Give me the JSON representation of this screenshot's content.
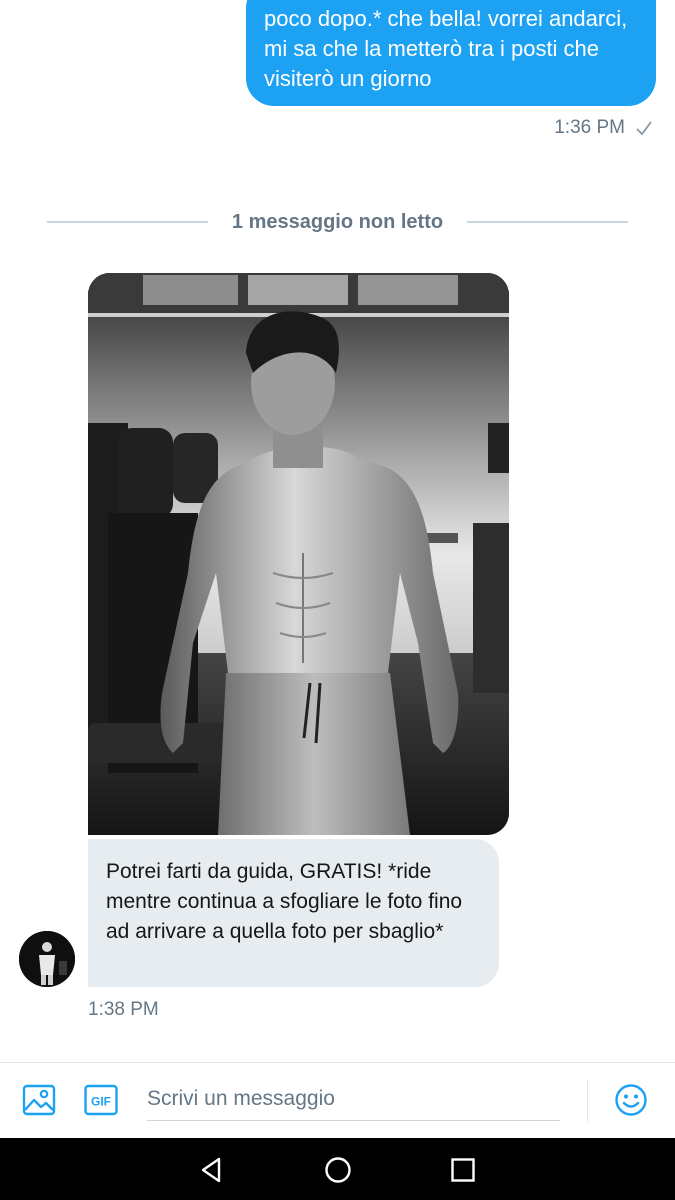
{
  "conversation": {
    "sent_message": {
      "text": "poco dopo.* che bella! vorrei andarci, mi sa che la metterò tra i posti che visiterò un giorno",
      "time": "1:36 PM",
      "status_icon": "check-icon"
    },
    "unread_divider": "1 messaggio non letto",
    "received_message": {
      "image": "shirtless-man-gym-photo",
      "text": "Potrei farti da guida, GRATIS! *ride mentre continua a sfogliare le foto fino ad arrivare a quella foto per sbaglio*",
      "time": "1:38 PM",
      "avatar": "avatar-person"
    }
  },
  "composer": {
    "placeholder": "Scrivi un messaggio",
    "image_icon": "image-icon",
    "gif_label": "GIF",
    "emoji_icon": "emoji-icon"
  },
  "navbar": {
    "icons": [
      "back-icon",
      "home-icon",
      "recents-icon"
    ]
  },
  "colors": {
    "accent": "#1da1f2",
    "received_bubble": "#e6ecf0",
    "meta_text": "#657786"
  }
}
